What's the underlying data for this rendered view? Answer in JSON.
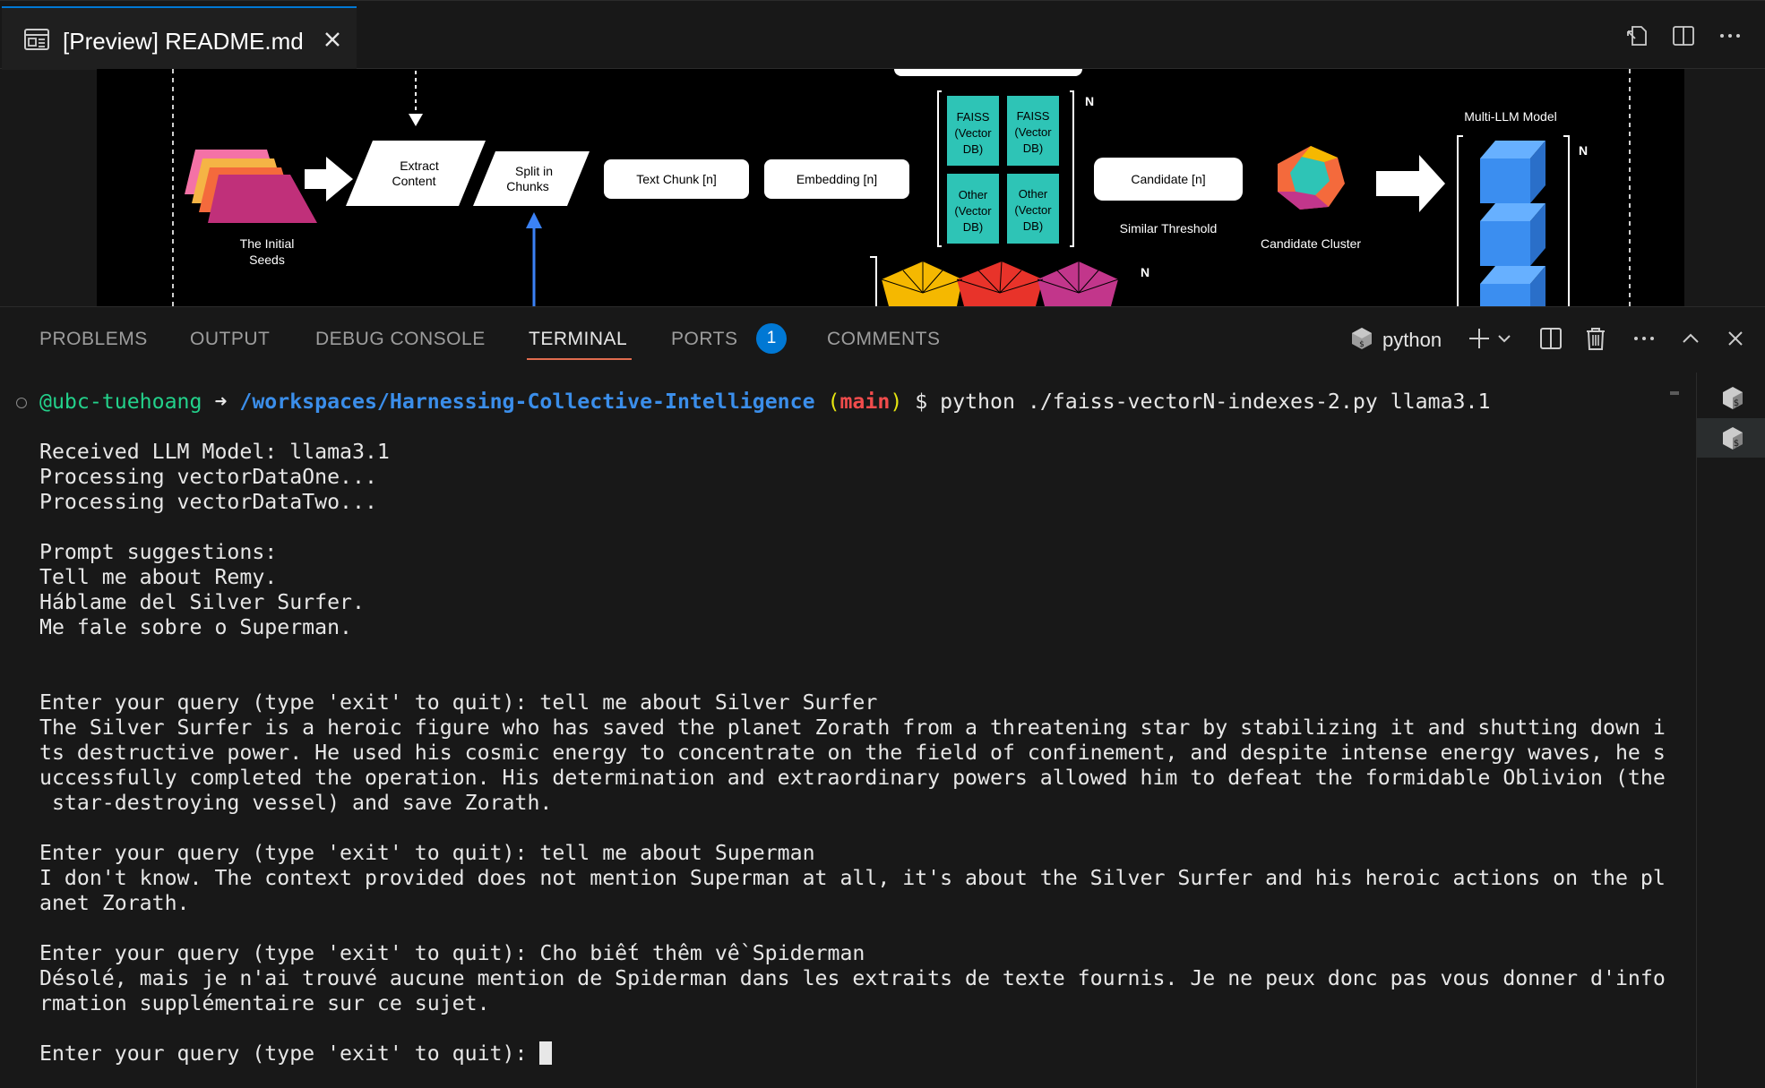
{
  "editor": {
    "tab_label": "[Preview] README.md"
  },
  "diagram": {
    "initial_seeds": [
      "The Initial",
      "Seeds"
    ],
    "extract_content": [
      "Extract",
      "Content"
    ],
    "split_chunks": [
      "Split in",
      "Chunks"
    ],
    "text_chunk": "Text Chunk [n]",
    "embedding": "Embedding [n]",
    "db_boxes": [
      [
        "FAISS",
        "(Vector",
        "DB)"
      ],
      [
        "FAISS",
        "(Vector",
        "DB)"
      ],
      [
        "Other",
        "(Vector",
        "DB)"
      ],
      [
        "Other",
        "(Vector",
        "DB)"
      ]
    ],
    "n_label": "N",
    "candidate": "Candidate [n]",
    "similar_threshold": "Similar Threshold",
    "candidate_cluster": "Candidate Cluster",
    "multi_llm_model": "Multi-LLM Model"
  },
  "panel": {
    "tabs": [
      {
        "label": "PROBLEMS",
        "active": false
      },
      {
        "label": "OUTPUT",
        "active": false
      },
      {
        "label": "DEBUG CONSOLE",
        "active": false
      },
      {
        "label": "TERMINAL",
        "active": true
      },
      {
        "label": "PORTS",
        "active": false
      },
      {
        "label": "COMMENTS",
        "active": false
      }
    ],
    "ports_badge": "1",
    "terminal_profile": "python"
  },
  "terminal": {
    "prompt_user": "@ubc-tuehoang",
    "prompt_arrow": " ➜ ",
    "prompt_path": "/workspaces/Harnessing-Collective-Intelligence",
    "prompt_branch_open": " (",
    "prompt_branch": "main",
    "prompt_branch_close": ")",
    "prompt_command": " $ python ./faiss-vectorN-indexes-2.py llama3.1",
    "lines": [
      "Received LLM Model: llama3.1",
      "Processing vectorDataOne...",
      "Processing vectorDataTwo...",
      "",
      "Prompt suggestions:",
      "Tell me about Remy.",
      "Háblame del Silver Surfer.",
      "Me fale sobre o Superman.",
      "",
      "",
      "Enter your query (type 'exit' to quit): tell me about Silver Surfer",
      "The Silver Surfer is a heroic figure who has saved the planet Zorath from a threatening star by stabilizing it and shutting down i",
      "ts destructive power. He used his cosmic energy to concentrate on the field of confinement, and despite intense energy waves, he s",
      "uccessfully completed the operation. His determination and extraordinary powers allowed him to defeat the formidable Oblivion (the",
      " star-destroying vessel) and save Zorath.",
      "",
      "Enter your query (type 'exit' to quit): tell me about Superman",
      "I don't know. The context provided does not mention Superman at all, it's about the Silver Surfer and his heroic actions on the pl",
      "anet Zorath.",
      "",
      "Enter your query (type 'exit' to quit): Cho biết thêm về Spiderman",
      "Désolé, mais je n'ai trouvé aucune mention de Spiderman dans les extraits de texte fournis. Je ne peux donc pas vous donner d'info",
      "rmation supplémentaire sur ce sujet.",
      "",
      "Enter your query (type 'exit' to quit): "
    ]
  },
  "colors": {
    "accent": "#0078d4",
    "terminal_tab_underline": "#e06c4f",
    "prompt_user": "#23d18b",
    "prompt_path": "#3b8eea",
    "prompt_branch": "#f14c4c"
  }
}
